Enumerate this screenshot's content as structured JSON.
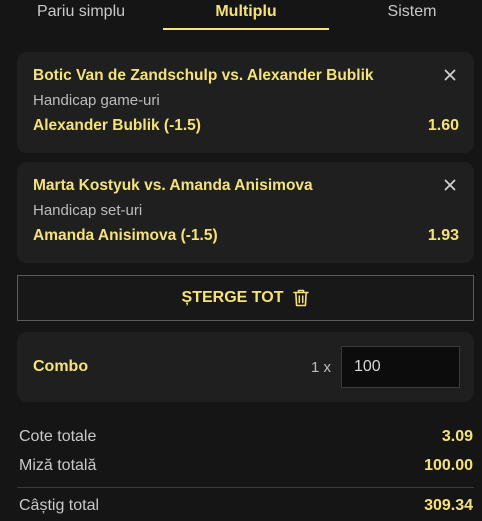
{
  "tabs": [
    {
      "label": "Pariu simplu",
      "active": false
    },
    {
      "label": "Multiplu",
      "active": true
    },
    {
      "label": "Sistem",
      "active": false
    }
  ],
  "bets": [
    {
      "event": "Botic Van de Zandschulp vs. Alexander Bublik",
      "market": "Handicap game-uri",
      "selection": "Alexander Bublik (-1.5)",
      "odds": "1.60"
    },
    {
      "event": "Marta Kostyuk vs. Amanda Anisimova",
      "market": "Handicap set-uri",
      "selection": "Amanda Anisimova (-1.5)",
      "odds": "1.93"
    }
  ],
  "delete_all": {
    "label": "ȘTERGE TOT",
    "icon": "trash-icon"
  },
  "combo": {
    "label": "Combo",
    "multiplier": "1 x",
    "stake": "100"
  },
  "summary": {
    "total_odds_label": "Cote totale",
    "total_odds": "3.09",
    "total_stake_label": "Miză totală",
    "total_stake": "100.00",
    "total_win_label": "Câștig total",
    "total_win": "309.34"
  },
  "colors": {
    "accent": "#f4e27a",
    "background": "#151515",
    "card": "#1f1f1f",
    "muted_text": "#bdbdbd"
  }
}
